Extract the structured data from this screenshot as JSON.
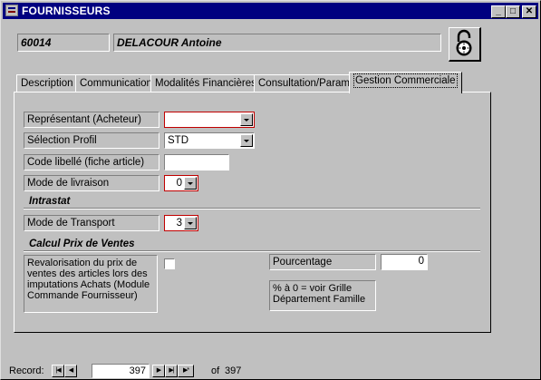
{
  "window": {
    "title": "FOURNISSEURS",
    "minimize": "_",
    "maximize": "□",
    "close": "✕"
  },
  "header": {
    "code": "60014",
    "name": "DELACOUR Antoine",
    "lock_icon": "padlock-icon"
  },
  "tabs": [
    "Description",
    "Communication",
    "Modalités Financières",
    "Consultation/Param",
    "Gestion Commerciale"
  ],
  "active_tab": "Gestion Commerciale",
  "form": {
    "representant_label": "Représentant (Acheteur)",
    "representant_value": "",
    "profil_label": "Sélection Profil",
    "profil_value": "STD",
    "code_libelle_label": "Code libellé (fiche article)",
    "code_libelle_value": "",
    "mode_livraison_label": "Mode de livraison",
    "mode_livraison_value": "0",
    "intrastat_heading": "Intrastat",
    "mode_transport_label": "Mode de Transport",
    "mode_transport_value": "3",
    "calcul_heading": "Calcul Prix de Ventes",
    "revalorisation_label": "Revalorisation du prix de ventes des articles lors des imputations Achats (Module Commande Fournisseur)",
    "revalorisation_checked": false,
    "pourcentage_label": "Pourcentage",
    "pourcentage_value": "0",
    "note": "% à 0 = voir Grille Département Famille"
  },
  "navigator": {
    "label": "Record:",
    "current": "397",
    "of_label": "of",
    "total": "397"
  },
  "colors": {
    "title_bar": "#000080",
    "required_border": "#c00000",
    "face": "#c0c0c0"
  }
}
